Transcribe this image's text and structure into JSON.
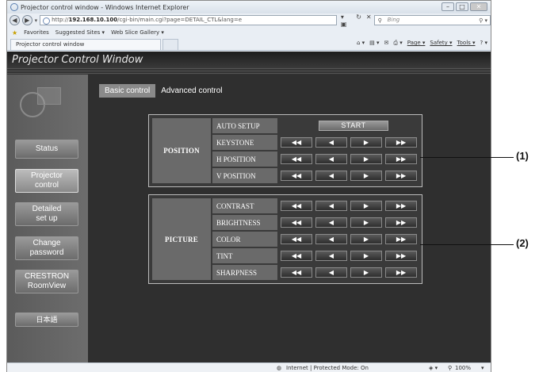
{
  "browser": {
    "window_title": "Projector control window - Windows Internet Explorer",
    "url_pre": "http://",
    "url_host": "192.168.10.100",
    "url_rest": "/cgi-bin/main.cgi?page=DETAIL_CTL&lang=e",
    "search_placeholder": "Bing",
    "favorites_label": "Favorites",
    "fav_items": [
      "Suggested Sites ▾",
      "Web Slice Gallery ▾"
    ],
    "tab_title": "Projector control window",
    "commands": [
      "Page ▾",
      "Safety ▾",
      "Tools ▾"
    ],
    "status_text": "Internet | Protected Mode: On",
    "zoom": "100%",
    "window_buttons": [
      "–",
      "□",
      "✕"
    ]
  },
  "page": {
    "title": "Projector Control Window",
    "nav": [
      {
        "label": "Status",
        "active": false
      },
      {
        "label": "Projector\ncontrol",
        "active": true
      },
      {
        "label": "Detailed\nset up",
        "active": false
      },
      {
        "label": "Change\npassword",
        "active": false
      },
      {
        "label": "CRESTRON\nRoomView",
        "active": false
      },
      {
        "label": "日本語",
        "active": false
      }
    ],
    "tabs": {
      "basic": "Basic control",
      "advanced": "Advanced control"
    },
    "position_group": {
      "name": "POSITION",
      "auto_setup": {
        "label": "AUTO SETUP",
        "button": "START"
      },
      "rows": [
        "KEYSTONE",
        "H POSITION",
        "V POSITION"
      ]
    },
    "picture_group": {
      "name": "PICTURE",
      "rows": [
        "CONTRAST",
        "BRIGHTNESS",
        "COLOR",
        "TINT",
        "SHARPNESS"
      ]
    },
    "adjust_buttons": [
      "◀◀",
      "◀",
      "▶",
      "▶▶"
    ]
  },
  "callouts": [
    "(1)",
    "(2)"
  ]
}
